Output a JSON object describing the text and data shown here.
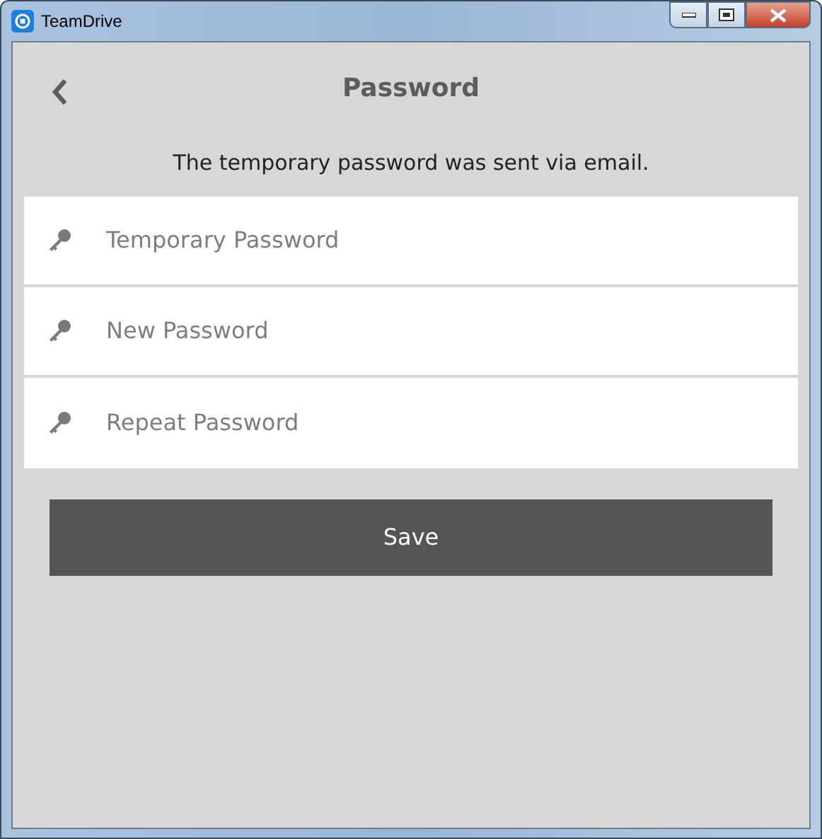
{
  "window": {
    "title": "TeamDrive"
  },
  "header": {
    "title": "Password"
  },
  "message": "The temporary password was sent via email.",
  "fields": [
    {
      "placeholder": "Temporary Password"
    },
    {
      "placeholder": "New Password"
    },
    {
      "placeholder": "Repeat Password"
    }
  ],
  "save_button": "Save"
}
